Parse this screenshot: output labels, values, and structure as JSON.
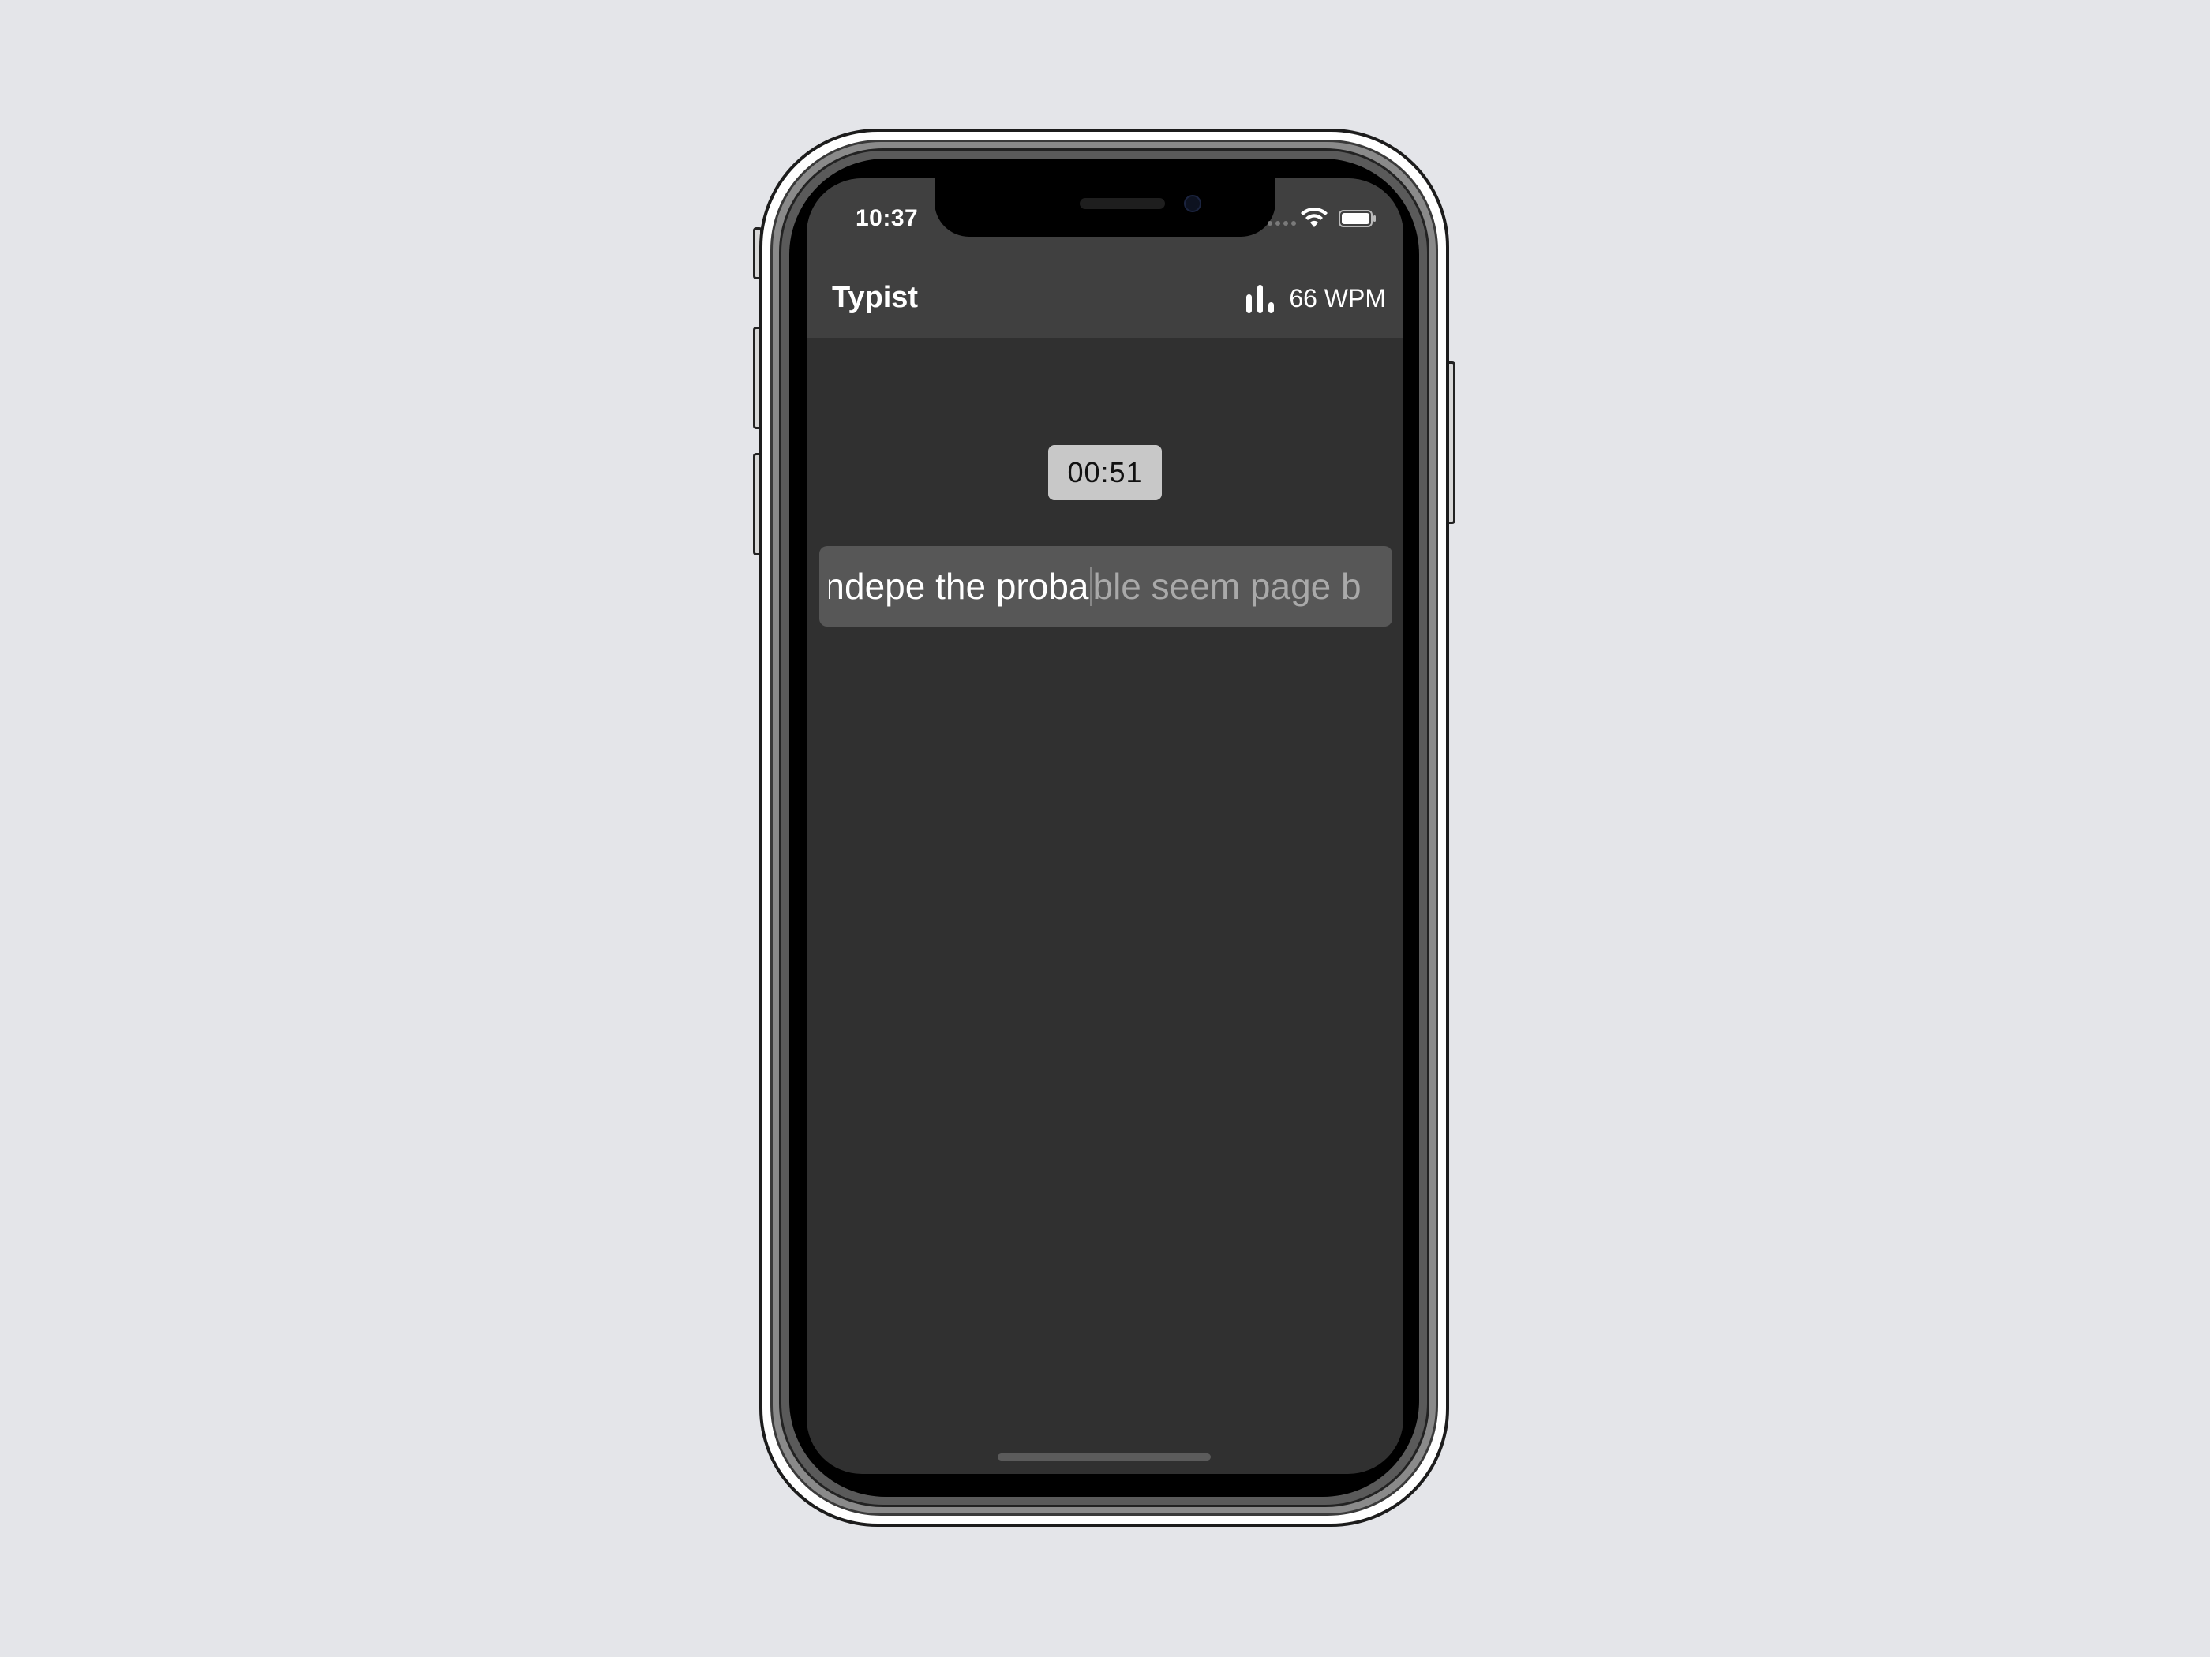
{
  "status_bar": {
    "time": "10:37",
    "icons": [
      "cellular-signal-icon",
      "wifi-icon",
      "battery-icon"
    ]
  },
  "app": {
    "title": "Typist",
    "wpm_icon": "bar-chart-icon",
    "wpm_label": "66 WPM"
  },
  "timer": {
    "value": "00:51"
  },
  "typing": {
    "typed_text": "ndepe the proba",
    "remaining_text": "ble seem page b"
  },
  "colors": {
    "background": "#e4e5e9",
    "screen": "#303030",
    "nav_bar": "#404040",
    "timer_bg": "#c8c8c8",
    "typing_box": "#575757",
    "typed_text": "#ffffff",
    "remaining_text": "#a9a9a9"
  }
}
